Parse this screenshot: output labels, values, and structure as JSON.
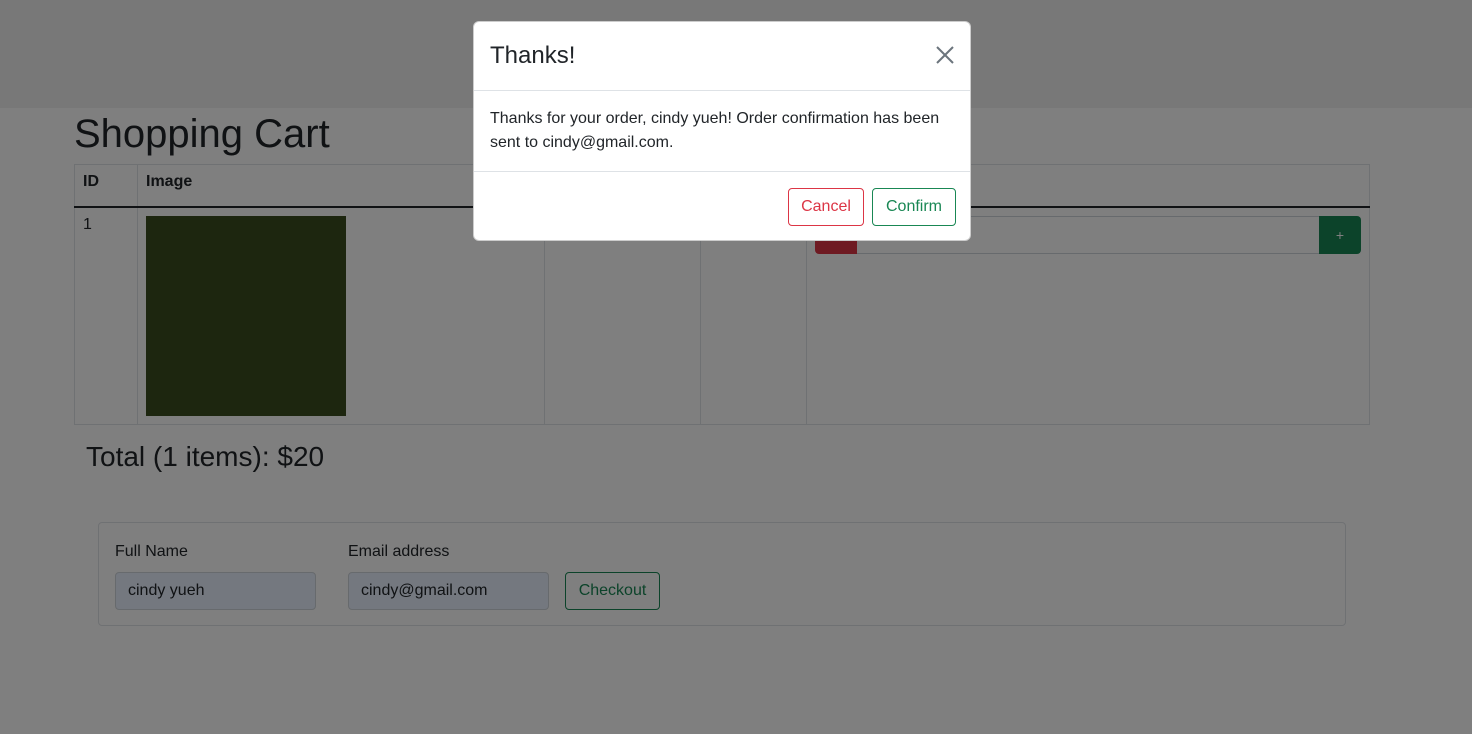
{
  "page": {
    "title": "Shopping Cart",
    "total_text": "Total (1 items): $20"
  },
  "cart": {
    "columns": [
      "ID",
      "Image",
      "",
      "",
      ""
    ],
    "rows": [
      {
        "id": "1",
        "image_color": "#3a4d1f",
        "minus_label": "-",
        "plus_label": "+"
      }
    ]
  },
  "checkout_form": {
    "name_label": "Full Name",
    "name_value": "cindy yueh",
    "email_label": "Email address",
    "email_value": "cindy@gmail.com",
    "checkout_label": "Checkout"
  },
  "modal": {
    "title": "Thanks!",
    "body": "Thanks for your order, cindy yueh! Order confirmation has been sent to cindy@gmail.com.",
    "cancel_label": "Cancel",
    "confirm_label": "Confirm",
    "close_icon": "close-icon"
  },
  "colors": {
    "danger": "#dc3545",
    "success": "#198754",
    "backdrop": "rgba(0,0,0,0.5)"
  }
}
